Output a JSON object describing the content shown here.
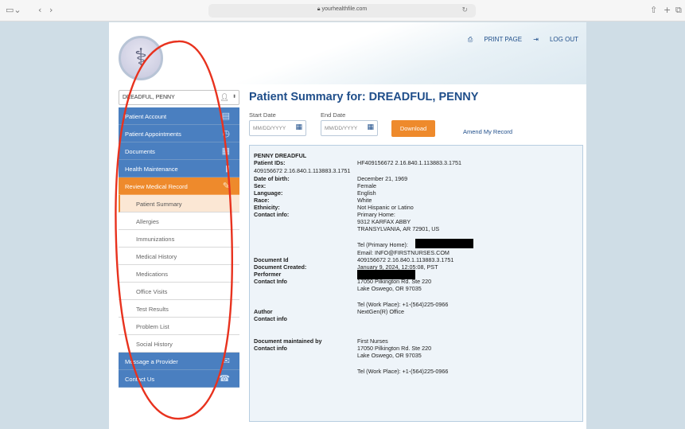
{
  "browser": {
    "url": "yourhealthfile.com"
  },
  "header": {
    "print_label": "PRINT PAGE",
    "logout_label": "LOG OUT"
  },
  "sidebar": {
    "patient_select_value": "DREADFUL, PENNY",
    "nav": [
      {
        "label": "Patient Account",
        "icon": "id-card-icon"
      },
      {
        "label": "Patient Appointments",
        "icon": "clock-icon"
      },
      {
        "label": "Documents",
        "icon": "document-icon"
      },
      {
        "label": "Health Maintenance",
        "icon": "bar-chart-icon"
      },
      {
        "label": "Review Medical Record",
        "icon": "edit-icon"
      }
    ],
    "sub": [
      {
        "label": "Patient Summary"
      },
      {
        "label": "Allergies"
      },
      {
        "label": "Immunizations"
      },
      {
        "label": "Medical History"
      },
      {
        "label": "Medications"
      },
      {
        "label": "Office Visits"
      },
      {
        "label": "Test Results"
      },
      {
        "label": "Problem List"
      },
      {
        "label": "Social History"
      }
    ],
    "bottom_nav": [
      {
        "label": "Message a Provider",
        "icon": "message-icon"
      },
      {
        "label": "Contact Us",
        "icon": "contact-icon"
      }
    ]
  },
  "main": {
    "title": "Patient Summary for: DREADFUL, PENNY",
    "start_date_label": "Start Date",
    "end_date_label": "End Date",
    "date_placeholder": "MM/DD/YYYY",
    "download_label": "Download",
    "amend_label": "Amend My Record"
  },
  "summary": {
    "name": "PENNY DREADFUL",
    "patient_ids_label": "Patient IDs:",
    "patient_ids_value": "HF409156672 2.16.840.1.113883.3.1751",
    "patient_ids_wrap": "409156672 2.16.840.1.113883.3.1751",
    "dob_label": "Date of birth:",
    "dob_value": "December 21, 1969",
    "sex_label": "Sex:",
    "sex_value": "Female",
    "language_label": "Language:",
    "language_value": "English",
    "race_label": "Race:",
    "race_value": "White",
    "ethnicity_label": "Ethnicity:",
    "ethnicity_value": "Not Hispanic or Latino",
    "contact_label": "Contact info:",
    "contact_type": "Primary Home:",
    "address1": "9312 KARFAX ABBY",
    "address2": "TRANSYLVANIA, AR 72901, US",
    "tel_primary_label": "Tel (Primary Home):",
    "email": "Email: INFO@FIRSTNURSES.COM",
    "doc_id_label": "Document Id",
    "doc_id_value": "409156672 2.16.840.1.113883.3.1751",
    "doc_created_label": "Document Created:",
    "doc_created_value": "January 9, 2024, 12:05:08, PST",
    "performer_label": "Performer",
    "perf_contact_label": "Contact Info",
    "perf_addr1": "17050 Pilkington Rd. Ste 220",
    "perf_addr2": "Lake Oswego, OR 97035",
    "perf_tel": "Tel (Work Place): +1-(564)225-0966",
    "author_label": "Author",
    "author_value": "NextGen(R) Office",
    "author_contact_label": "Contact info",
    "maintained_label": "Document maintained by",
    "maintained_value": "First Nurses",
    "maint_contact_label": "Contact info",
    "maint_addr1": "17050 Pilkington Rd. Ste 220",
    "maint_addr2": "Lake Oswego, OR 97035",
    "maint_tel": "Tel (Work Place): +1-(564)225-0966"
  },
  "colors": {
    "nav_blue": "#4a7fc0",
    "nav_orange": "#ee8a2c",
    "title_blue": "#1f4e8a",
    "annotation_red": "#e8321e"
  }
}
